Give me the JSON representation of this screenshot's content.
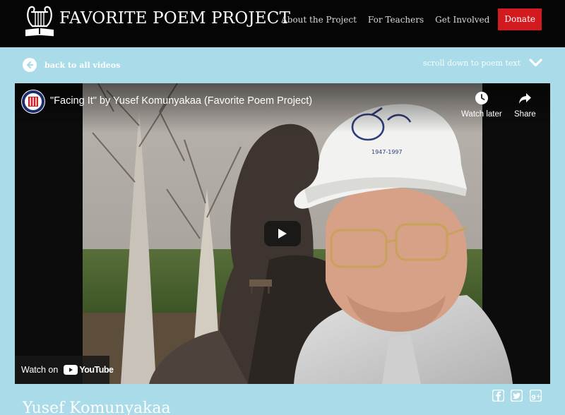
{
  "header": {
    "site_title": "FAVORITE POEM PROJECT",
    "nav": [
      "About the Project",
      "For Teachers",
      "Get Involved"
    ],
    "donate": "Donate"
  },
  "subbar": {
    "back": "back to all videos",
    "scroll": "scroll down to poem text"
  },
  "video": {
    "title": "\"Facing It\" by Yusef Komunyakaa (Favorite Poem Project)",
    "watch_later": "Watch later",
    "share": "Share",
    "watch_on": "Watch on",
    "youtube": "YouTube"
  },
  "poet": {
    "name": "Yusef Komunyakaa"
  },
  "social_icons": [
    "facebook-icon",
    "twitter-icon",
    "google-plus-icon"
  ],
  "colors": {
    "header_bg": "#050505",
    "page_bg": "#a9dbe9",
    "donate_bg": "#d31a1f"
  }
}
